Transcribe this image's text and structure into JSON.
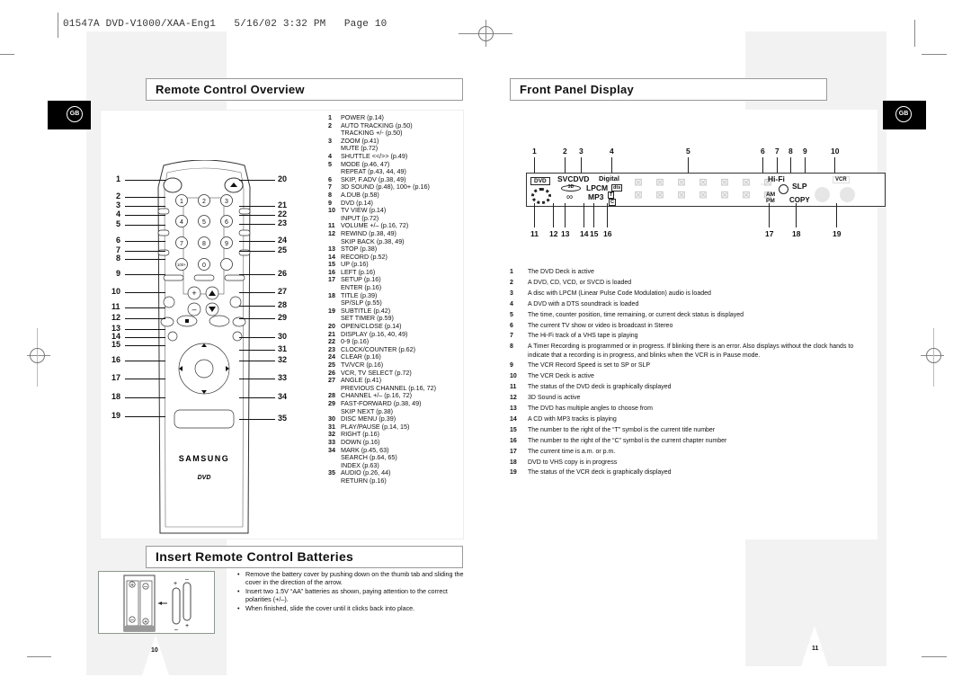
{
  "print_header": "01547A DVD-V1000/XAA-Eng1   5/16/02 3:32 PM   Page 10",
  "language_badge": "GB",
  "sections": {
    "remote_overview": "Remote Control Overview",
    "front_panel": "Front Panel Display",
    "batteries": "Insert Remote Control Batteries"
  },
  "remote_items": [
    {
      "num": "1",
      "text": "POWER (p.14)"
    },
    {
      "num": "2",
      "text": "AUTO TRACKING  (p.50)"
    },
    {
      "num": "",
      "text": "TRACKING +/- (p.50)"
    },
    {
      "num": "3",
      "text": "ZOOM (p.41)"
    },
    {
      "num": "",
      "text": "MUTE (p.72)"
    },
    {
      "num": "4",
      "text": "SHUTTLE <</>> (p.49)"
    },
    {
      "num": "5",
      "text": "MODE (p.46, 47)"
    },
    {
      "num": "",
      "text": "REPEAT (p.43, 44, 49)"
    },
    {
      "num": "6",
      "text": "SKIP, F.ADV (p.38, 49)"
    },
    {
      "num": "7",
      "text": "3D SOUND (p.48), 100+ (p.16)"
    },
    {
      "num": "8",
      "text": "A.DUB (p.58)"
    },
    {
      "num": "9",
      "text": "DVD (p.14)"
    },
    {
      "num": "10",
      "text": "TV VIEW (p.14)"
    },
    {
      "num": "",
      "text": "INPUT (p.72)"
    },
    {
      "num": "11",
      "text": "VOLUME +/– (p.16, 72)"
    },
    {
      "num": "12",
      "text": "REWIND (p.38, 49)"
    },
    {
      "num": "",
      "text": "SKIP BACK (p.38, 49)"
    },
    {
      "num": "13",
      "text": "STOP (p.38)"
    },
    {
      "num": "14",
      "text": "RECORD (p.52)"
    },
    {
      "num": "15",
      "text": "UP (p.16)"
    },
    {
      "num": "16",
      "text": "LEFT (p.16)"
    },
    {
      "num": "17",
      "text": "SETUP (p.16)"
    },
    {
      "num": "",
      "text": "ENTER (p.16)"
    },
    {
      "num": "18",
      "text": "TITLE (p.39)"
    },
    {
      "num": "",
      "text": "SP/SLP (p.55)"
    },
    {
      "num": "19",
      "text": "SUBTITLE (p.42)"
    },
    {
      "num": "",
      "text": "SET TIMER (p.59)"
    },
    {
      "num": "20",
      "text": "OPEN/CLOSE (p.14)"
    },
    {
      "num": "21",
      "text": "DISPLAY (p.16, 40, 49)"
    },
    {
      "num": "22",
      "text": "0-9 (p.16)"
    },
    {
      "num": "23",
      "text": "CLOCK/COUNTER (p.62)"
    },
    {
      "num": "24",
      "text": "CLEAR (p.16)"
    },
    {
      "num": "25",
      "text": "TV/VCR (p.16)"
    },
    {
      "num": "26",
      "text": "VCR, TV SELECT (p.72)"
    },
    {
      "num": "27",
      "text": "ANGLE (p.41)"
    },
    {
      "num": "",
      "text": "PREVIOUS CHANNEL (p.16, 72)"
    },
    {
      "num": "28",
      "text": "CHANNEL +/– (p.16, 72)"
    },
    {
      "num": "29",
      "text": "FAST-FORWARD (p.38, 49)"
    },
    {
      "num": "",
      "text": "SKIP NEXT (p.38)"
    },
    {
      "num": "30",
      "text": "DISC MENU (p.39)"
    },
    {
      "num": "31",
      "text": "PLAY/PAUSE (p.14, 15)"
    },
    {
      "num": "32",
      "text": "RIGHT (p.16)"
    },
    {
      "num": "33",
      "text": "DOWN (p.16)"
    },
    {
      "num": "34",
      "text": "MARK (p.45, 63)"
    },
    {
      "num": "",
      "text": "SEARCH (p.64, 65)"
    },
    {
      "num": "",
      "text": "INDEX (p.63)"
    },
    {
      "num": "35",
      "text": "AUDIO (p.26, 44)"
    },
    {
      "num": "",
      "text": "RETURN (p.16)"
    }
  ],
  "remote_callouts_left": [
    "1",
    "2",
    "3",
    "4",
    "5",
    "6",
    "7",
    "8",
    "9",
    "10",
    "11",
    "12",
    "13",
    "14",
    "15",
    "16",
    "17",
    "18",
    "19"
  ],
  "remote_callouts_right": [
    "20",
    "21",
    "22",
    "23",
    "24",
    "25",
    "26",
    "27",
    "28",
    "29",
    "30",
    "31",
    "32",
    "33",
    "34",
    "35"
  ],
  "remote_labels": {
    "power": "POWER",
    "open_close": "OPEN/CLOSE",
    "brand": "SAMSUNG",
    "logo": "DVD",
    "keys": [
      "1",
      "2",
      "3",
      "4",
      "5",
      "6",
      "7",
      "8",
      "9",
      "100+",
      "0",
      ""
    ]
  },
  "front_panel": {
    "top_numbers": [
      "1",
      "2",
      "3",
      "4",
      "5",
      "6",
      "7",
      "8",
      "9",
      "10"
    ],
    "bottom_numbers": [
      "11",
      "12",
      "13",
      "14",
      "15",
      "16",
      "17",
      "18",
      "19"
    ],
    "indicators": {
      "dvd": "DVD",
      "svcdvd": "SVCDVD",
      "digital": "Digital",
      "lpcm": "LPCM",
      "dts": "dts",
      "mp3": "MP3",
      "t": "T",
      "c": "C",
      "three_d": "3D",
      "hifi": "Hi-Fi",
      "slp": "SLP",
      "am": "AM",
      "pm": "PM",
      "copy": "COPY",
      "vcr": "VCR"
    },
    "descriptions": [
      {
        "num": "1",
        "text": "The DVD Deck is active"
      },
      {
        "num": "2",
        "text": "A DVD, CD, VCD, or SVCD is loaded"
      },
      {
        "num": "3",
        "text": "A disc with LPCM (Linear Pulse Code Modulation) audio is loaded"
      },
      {
        "num": "4",
        "text": "A DVD with a DTS soundtrack is loaded"
      },
      {
        "num": "5",
        "text": "The time, counter position, time remaining, or current deck status is displayed"
      },
      {
        "num": "6",
        "text": "The current TV show or video is broadcast in Stereo"
      },
      {
        "num": "7",
        "text": "The Hi-Fi track of a VHS tape is playing"
      },
      {
        "num": "8",
        "text": "A Timer Recording is programmed or in progress. If blinking there is an error. Also displays without the clock hands to indicate that a recording is in progress, and blinks when the VCR is in Pause mode."
      },
      {
        "num": "9",
        "text": "The VCR Record Speed is set to SP or SLP"
      },
      {
        "num": "10",
        "text": "The VCR Deck is active"
      },
      {
        "num": "11",
        "text": "The status of the DVD deck is graphically displayed"
      },
      {
        "num": "12",
        "text": "3D Sound is active"
      },
      {
        "num": "13",
        "text": "The DVD has multiple angles to choose from"
      },
      {
        "num": "14",
        "text": "A CD with MP3 tracks is playing"
      },
      {
        "num": "15",
        "text": "The number to the right of the “T” symbol is the current title number"
      },
      {
        "num": "16",
        "text": "The number to the right of the “C” symbol is the current chapter number"
      },
      {
        "num": "17",
        "text": "The current time is a.m. or p.m."
      },
      {
        "num": "18",
        "text": "DVD to VHS copy is in progress"
      },
      {
        "num": "19",
        "text": "The status of the VCR deck is graphically displayed"
      }
    ]
  },
  "batteries": {
    "steps": [
      "Remove the battery cover by pushing down on the thumb tab and sliding the cover in the direction of the arrow.",
      "Insert two 1.5V “AA” batteries as shown, paying attention to the correct polarities (+/–).",
      "When finished, slide the cover until it clicks back into place."
    ],
    "bullet": "•",
    "plus": "+",
    "minus": "–"
  },
  "page_numbers": {
    "left": "10",
    "right": "11"
  }
}
